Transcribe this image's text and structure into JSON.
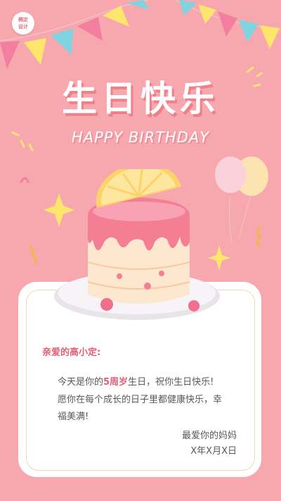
{
  "logo": {
    "line1": "稿定",
    "line2": "设计"
  },
  "title": {
    "main": "生日快乐",
    "sub": "HAPPY BIRTHDAY"
  },
  "letter": {
    "greeting": "亲爱的高小定:",
    "line1_pre": "今天是你的",
    "line1_highlight": "5周岁",
    "line1_post": "生日，祝你生日快乐!",
    "line2": "愿你在每个成长的日子里都健康快乐，幸",
    "line3": "福美满!",
    "signature": "最爱你的妈妈",
    "date": "X年X月X日"
  },
  "colors": {
    "background": "#f7a8ae",
    "accent": "#e25d76",
    "card": "#ffffff"
  }
}
